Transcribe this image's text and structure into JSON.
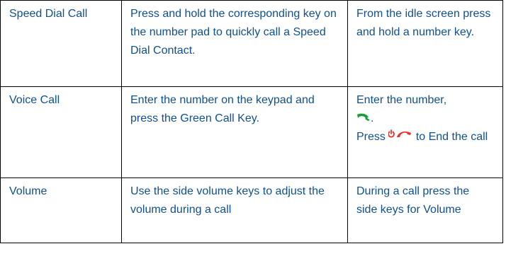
{
  "rows": [
    {
      "feature": "Speed Dial Call",
      "description": "Press and hold the corresponding key on the number pad to quickly call a Speed Dial Contact.",
      "how_to": "From the idle screen press and hold a number key."
    },
    {
      "feature": "Voice Call",
      "description": "Enter the number on the keypad and press the Green Call Key.",
      "how_to_line1": "Enter the number,",
      "how_to_after_green": ".",
      "how_to_press": "Press",
      "how_to_end": "to End the call"
    },
    {
      "feature": "Volume",
      "description": "Use the side volume keys to adjust the volume during a call",
      "how_to_line1": "During a call press the",
      "how_to_line2": "side keys for Volume"
    }
  ],
  "icons": {
    "call": {
      "name": "green-call-icon",
      "color": "#1a9e3a"
    },
    "end": {
      "name": "red-end-call-icon",
      "color": "#e8322a"
    }
  }
}
